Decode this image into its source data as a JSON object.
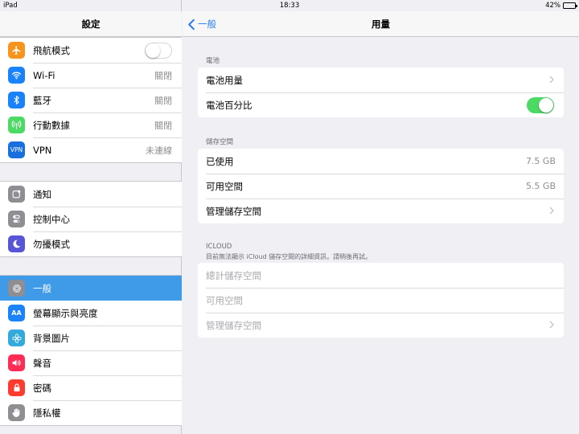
{
  "status_bar": {
    "device": "iPad",
    "time": "18:33",
    "battery": "42%",
    "battery_level": 0.42
  },
  "sidebar": {
    "title": "設定",
    "groups": [
      [
        {
          "label": "飛航模式",
          "icon": "airplane-icon",
          "color": "#f7941d",
          "toggle": "off"
        },
        {
          "label": "Wi-Fi",
          "icon": "wifi-icon",
          "color": "#1a82fb",
          "value": "關閉"
        },
        {
          "label": "藍牙",
          "icon": "bluetooth-icon",
          "color": "#1a82fb",
          "value": "關閉"
        },
        {
          "label": "行動數據",
          "icon": "cellular-icon",
          "color": "#4cd964",
          "value": "關閉"
        },
        {
          "label": "VPN",
          "icon": "vpn-icon",
          "color": "#1a6fe0",
          "value": "未連線"
        }
      ],
      [
        {
          "label": "通知",
          "icon": "notifications-icon",
          "color": "#8e8e93"
        },
        {
          "label": "控制中心",
          "icon": "control-center-icon",
          "color": "#8e8e93"
        },
        {
          "label": "勿擾模式",
          "icon": "moon-icon",
          "color": "#5856d6"
        }
      ],
      [
        {
          "label": "一般",
          "icon": "gear-icon",
          "color": "#8e8e93",
          "selected": true
        },
        {
          "label": "螢幕顯示與亮度",
          "icon": "display-icon",
          "color": "#1a82fb"
        },
        {
          "label": "背景圖片",
          "icon": "wallpaper-icon",
          "color": "#34aadc"
        },
        {
          "label": "聲音",
          "icon": "speaker-icon",
          "color": "#ff2d55"
        },
        {
          "label": "密碼",
          "icon": "lock-icon",
          "color": "#ff3b30"
        },
        {
          "label": "隱私權",
          "icon": "hand-icon",
          "color": "#8e8e93"
        }
      ]
    ]
  },
  "detail": {
    "back_label": "一般",
    "title": "用量",
    "battery_section": {
      "header": "電池",
      "rows": [
        {
          "label": "電池用量",
          "chevron": true
        },
        {
          "label": "電池百分比",
          "toggle": "on"
        }
      ]
    },
    "storage_section": {
      "header": "儲存空間",
      "rows": [
        {
          "label": "已使用",
          "value": "7.5 GB"
        },
        {
          "label": "可用空間",
          "value": "5.5 GB"
        },
        {
          "label": "管理儲存空間",
          "chevron": true
        }
      ]
    },
    "icloud_section": {
      "header": "ICLOUD",
      "note": "目前無法顯示 iCloud 儲存空間的詳細資訊。請稍後再試。",
      "rows": [
        {
          "label": "總計儲存空間"
        },
        {
          "label": "可用空間"
        },
        {
          "label": "管理儲存空間",
          "chevron": true
        }
      ]
    }
  }
}
